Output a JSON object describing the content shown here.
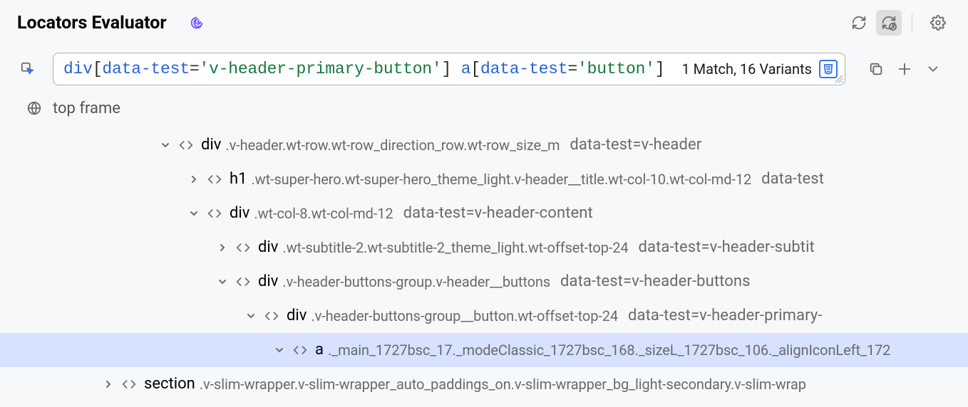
{
  "header": {
    "title": "Locators Evaluator"
  },
  "search": {
    "locator_parts": {
      "tag1": "div",
      "bracket1": "[",
      "attr1": "data-test",
      "eq1": "=",
      "q1a": "'",
      "val1": "v-header-primary-button",
      "q1b": "'",
      "bracket1c": "]",
      "space": " ",
      "tag2": "a",
      "bracket2": "[",
      "attr2": "data-test",
      "eq2": "=",
      "q2a": "'",
      "val2": "button",
      "q2b": "'",
      "bracket2c": "]"
    },
    "match_summary": "1 Match, 16 Variants",
    "css_badge": "⧉"
  },
  "frame": {
    "label": "top frame"
  },
  "tree": [
    {
      "indent": 218,
      "chev": "down",
      "tag": "div",
      "classes": ".v-header.wt-row.wt-row_direction_row.wt-row_size_m",
      "attr": "data-test=v-header",
      "hl": false
    },
    {
      "indent": 258,
      "chev": "right",
      "tag": "h1",
      "classes": ".wt-super-hero.wt-super-hero_theme_light.v-header__title.wt-col-10.wt-col-md-12",
      "attr": "data-test",
      "hl": false
    },
    {
      "indent": 258,
      "chev": "down",
      "tag": "div",
      "classes": ".wt-col-8.wt-col-md-12",
      "attr": "data-test=v-header-content",
      "hl": false
    },
    {
      "indent": 298,
      "chev": "right",
      "tag": "div",
      "classes": ".wt-subtitle-2.wt-subtitle-2_theme_light.wt-offset-top-24",
      "attr": "data-test=v-header-subtit",
      "hl": false
    },
    {
      "indent": 298,
      "chev": "down",
      "tag": "div",
      "classes": ".v-header-buttons-group.v-header__buttons",
      "attr": "data-test=v-header-buttons",
      "hl": false
    },
    {
      "indent": 338,
      "chev": "down",
      "tag": "div",
      "classes": ".v-header-buttons-group__button.wt-offset-top-24",
      "attr": "data-test=v-header-primary-",
      "hl": false
    },
    {
      "indent": 378,
      "chev": "down",
      "tag": "a",
      "classes": "._main_1727bsc_17._modeClassic_1727bsc_168._sizeL_1727bsc_106._alignIconLeft_172",
      "attr": "",
      "hl": true
    },
    {
      "indent": 138,
      "chev": "right",
      "tag": "section",
      "classes": ".v-slim-wrapper.v-slim-wrapper_auto_paddings_on.v-slim-wrapper_bg_light-secondary.v-slim-wrap",
      "attr": "",
      "hl": false
    }
  ]
}
